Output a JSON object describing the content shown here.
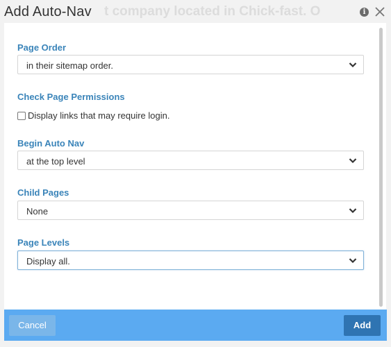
{
  "dialog": {
    "title": "Add Auto-Nav",
    "background_text": "t company located in Chick-fast. O",
    "icons": {
      "info": "info-icon",
      "close": "close-icon"
    }
  },
  "fields": {
    "page_order": {
      "label": "Page Order",
      "value": "in their sitemap order."
    },
    "permissions": {
      "label": "Check Page Permissions",
      "checkbox_label": "Display links that may require login.",
      "checked": false
    },
    "begin_auto_nav": {
      "label": "Begin Auto Nav",
      "value": "at the top level"
    },
    "child_pages": {
      "label": "Child Pages",
      "value": "None"
    },
    "page_levels": {
      "label": "Page Levels",
      "value": "Display all."
    }
  },
  "footer": {
    "cancel_label": "Cancel",
    "add_label": "Add"
  },
  "colors": {
    "label": "#3a84b9",
    "footer_bg": "#5baaf1",
    "cancel_bg": "#7ab6e9",
    "add_bg": "#2f74b2"
  }
}
